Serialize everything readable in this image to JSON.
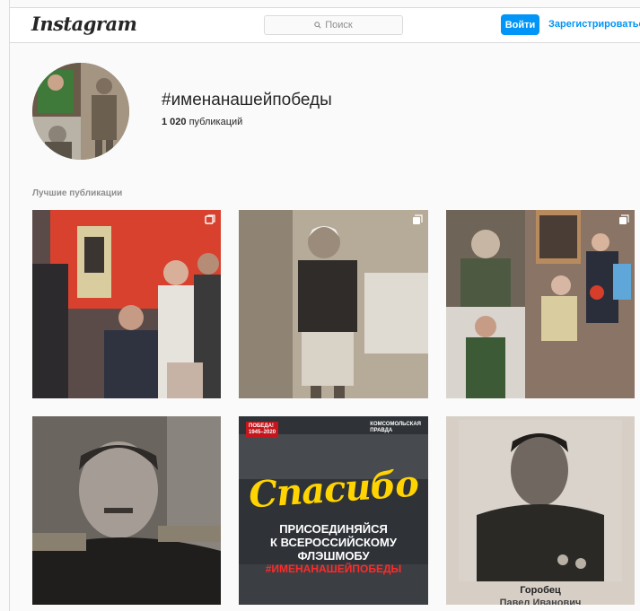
{
  "header": {
    "logo": "Instagram",
    "search_placeholder": "Поиск",
    "login_label": "Войти",
    "signup_label": "Зарегистрироваться"
  },
  "profile": {
    "hashtag": "#именанашейпобеды",
    "post_count": "1 020",
    "post_count_suffix": "публикаций"
  },
  "section": {
    "top_posts_label": "Лучшие публикации"
  },
  "posts": [
    {
      "icon": "carousel-icon"
    },
    {
      "icon": "multiple-posts-icon"
    },
    {
      "icon": "multiple-posts-icon"
    },
    {
      "icon": ""
    },
    {
      "icon": "",
      "badge_left_line1": "ПОБЕДА!",
      "badge_left_line2": "1945–2020",
      "badge_right_line1": "КОМСОМОЛЬСКАЯ",
      "badge_right_line2": "ПРАВДА",
      "title": "Спасибо",
      "text_line1": "ПРИСОЕДИНЯЙСЯ",
      "text_line2": "К ВСЕРОССИЙСКОМУ",
      "text_line3": "ФЛЭШМОБУ",
      "hashtag": "#ИМЕНАНАШЕЙПОБЕДЫ"
    },
    {
      "icon": "",
      "caption": "Горобец",
      "caption2": "Павел Иванович"
    }
  ],
  "colors": {
    "accent": "#0095f6",
    "text": "#262626",
    "muted": "#8e8e8e",
    "border": "#dbdbdb"
  }
}
